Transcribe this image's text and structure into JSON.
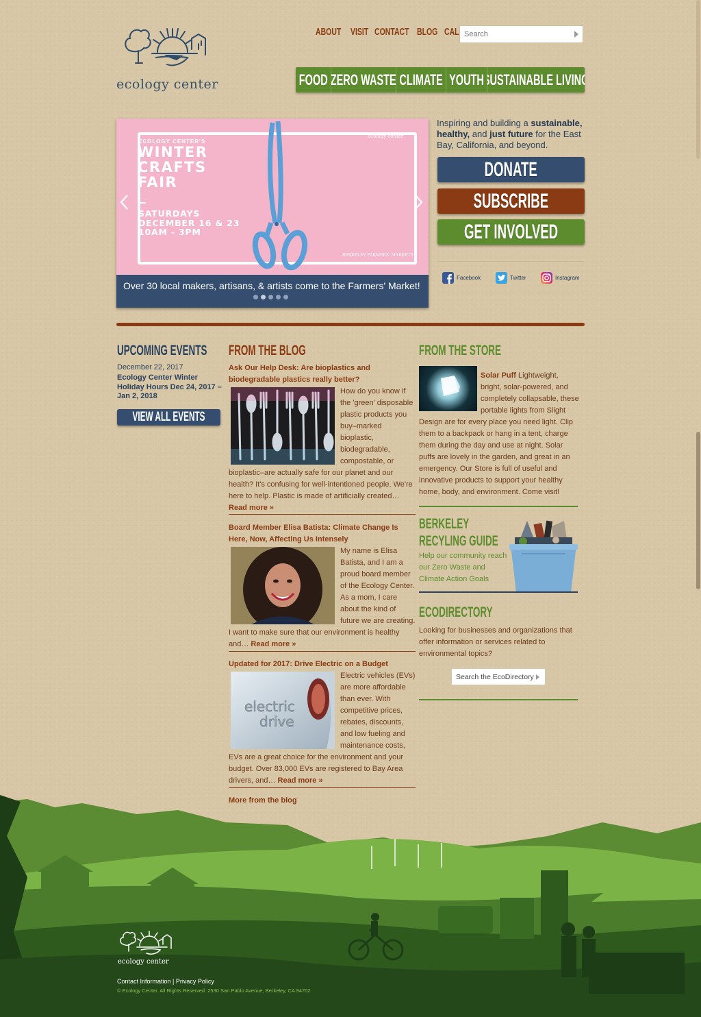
{
  "brand": {
    "name": "ecology center"
  },
  "topnav": [
    "ABOUT",
    "VISIT",
    "CONTACT",
    "BLOG",
    "CALENDAR"
  ],
  "search": {
    "placeholder": "Search"
  },
  "mainnav": [
    "FOOD",
    "ZERO WASTE",
    "CLIMATE",
    "YOUTH",
    "SUSTAINABLE LIVING"
  ],
  "slider": {
    "kicker": "ECOLOGY CENTER'S",
    "title": "WINTER CRAFTS FAIR",
    "date": "SATURDAYS DECEMBER 16 & 23 10AM - 3PM",
    "brand": "ecology center",
    "market": "BERKELEY FARMERS' MARKETS",
    "caption": "Over 30 local makers, artisans, & artists come to the Farmers' Market!",
    "dots": 5,
    "active_dot": 1
  },
  "mission": {
    "p1": "Inspiring and building a ",
    "b1": "sustainable, healthy,",
    "p2": " and ",
    "b2": "just future",
    "p3": " for the East Bay, California, and beyond."
  },
  "buttons": {
    "donate": "DONATE",
    "subscribe": "SUBSCRIBE",
    "involved": "GET INVOLVED"
  },
  "social": {
    "facebook": "Facebook",
    "twitter": "Twitter",
    "instagram": "Instagram"
  },
  "events": {
    "heading": "UPCOMING EVENTS",
    "date": "December 22, 2017",
    "title": "Ecology Center Winter Holiday Hours Dec 24, 2017 – Jan 2, 2018",
    "button": "VIEW ALL EVENTS"
  },
  "blog": {
    "heading": "FROM THE BLOG",
    "posts": [
      {
        "title": "Ask Our Help Desk: Are bioplastics and biodegradable plastics really better?",
        "body": "How do you know if the 'green' disposable plastic products you buy–marked bioplastic, biodegradable, compostable, or bioplastic–are actually safe for our planet and our health? It's confusing for well-intentioned people. We're here to help. Plastic is made of artificially created…",
        "more": "Read more »"
      },
      {
        "title": "Board Member Elisa Batista: Climate Change Is Here, Now, Affecting Us Intensely",
        "body": "My name is Elisa Batista, and I am a proud board member of the Ecology Center. As a mom, I care about the kind of future we are creating. I want to make sure that our environment is healthy and…",
        "more": "Read more »"
      },
      {
        "title": "Updated for 2017: Drive Electric on a Budget",
        "body": "Electric vehicles (EVs) are more affordable than ever. With competitive prices, rebates, discounts, and low fueling and maintenance costs, EVs are a great choice for the environment and your budget. Over 83,000 EVs are registered to Bay Area drivers, and…",
        "more": "Read more »",
        "img_text1": "electric",
        "img_text2": "drive"
      }
    ],
    "more_link": "More from the blog"
  },
  "store": {
    "heading": "FROM THE STORE",
    "product": "Solar Puff",
    "text": " Lightweight, bright, solar-powered, and completely collapsable, these portable lights from Slight Design are for every place you need light. Clip them to a backpack or hang in a tent, charge them during the day and use at night. Solar puffs are lovely in the garden, and great in an emergency. Our Store is full of useful and innovative products to support your healthy home, body, and environment. Come visit!"
  },
  "recycling": {
    "heading1": "BERKELEY",
    "heading2": "RECYLING GUIDE",
    "text": "Help our community reach our Zero Waste and Climate Action Goals"
  },
  "ecodirectory": {
    "heading": "ECODIRECTORY",
    "text": "Looking for businesses and organizations that offer information or services related to environmental topics?",
    "button": "Search the EcoDirectory"
  },
  "footer": {
    "logo_text": "ecology center",
    "contact": "Contact Information",
    "sep": " | ",
    "privacy": "Privacy Policy",
    "copyright": "© Ecology Center. All Rights Reserved. 2530 San Pablo Avenue, Berkeley, CA 94702"
  },
  "colors": {
    "brown": "#8a3b14",
    "navy": "#354e70",
    "green": "#5c8c2e",
    "background": "#d8c7a6",
    "slide_pink": "#f4b4c9"
  }
}
